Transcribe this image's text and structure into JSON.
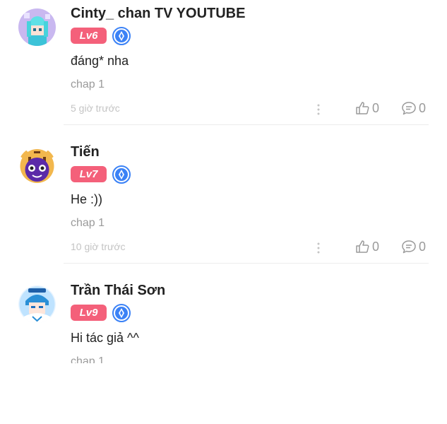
{
  "comments": [
    {
      "name": "Cinty_ chan TV YOUTUBE",
      "level": "Lv6",
      "text": "đáng* nha",
      "chapter": "chap 1",
      "time": "5 giờ trước",
      "likes": "0",
      "replies": "0",
      "avatar_icon": "anime-character-avatar"
    },
    {
      "name": "Tiến",
      "level": "Lv7",
      "text": "He :))",
      "chapter": "chap 1",
      "time": "10 giờ trước",
      "likes": "0",
      "replies": "0",
      "avatar_icon": "tiger-mascot-avatar"
    },
    {
      "name": "Trần Thái Sơn",
      "level": "Lv9",
      "text": "Hi tác giả ^^",
      "chapter": "chap 1",
      "time": "",
      "likes": "",
      "replies": "",
      "avatar_icon": "anime-boy-avatar"
    }
  ],
  "colors": {
    "level_badge": "#f4607a",
    "rank_badge": "#3b82f6",
    "muted": "#9a9a9a"
  }
}
